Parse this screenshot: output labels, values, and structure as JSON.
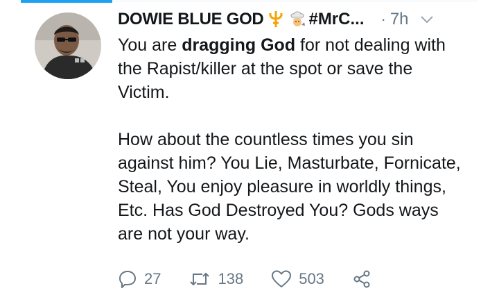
{
  "tweet": {
    "author_name": "DOWIE BLUE GOD",
    "handle_text": "#MrC...",
    "separator": "·",
    "time": "7h",
    "body_pre": "You are ",
    "body_bold": "dragging God",
    "body_post": " for not dealing with the Rapist/killer at the spot or save the Victim.\n\nHow about the countless times you sin against him? You Lie, Masturbate, Fornicate, Steal, You enjoy pleasure in worldly things, Etc. Has God Destroyed You? Gods ways are not your way."
  },
  "actions": {
    "reply_count": "27",
    "retweet_count": "138",
    "like_count": "503"
  },
  "icons": {
    "trident": "trident-emoji-icon",
    "chef": "chef-emoji-icon",
    "chevron": "chevron-down-icon",
    "reply": "reply-icon",
    "retweet": "retweet-icon",
    "like": "heart-icon",
    "share": "share-icon"
  },
  "colors": {
    "accent": "#1da1f2",
    "text": "#14171a",
    "muted": "#657786",
    "emoji_gold": "#f4a300"
  }
}
